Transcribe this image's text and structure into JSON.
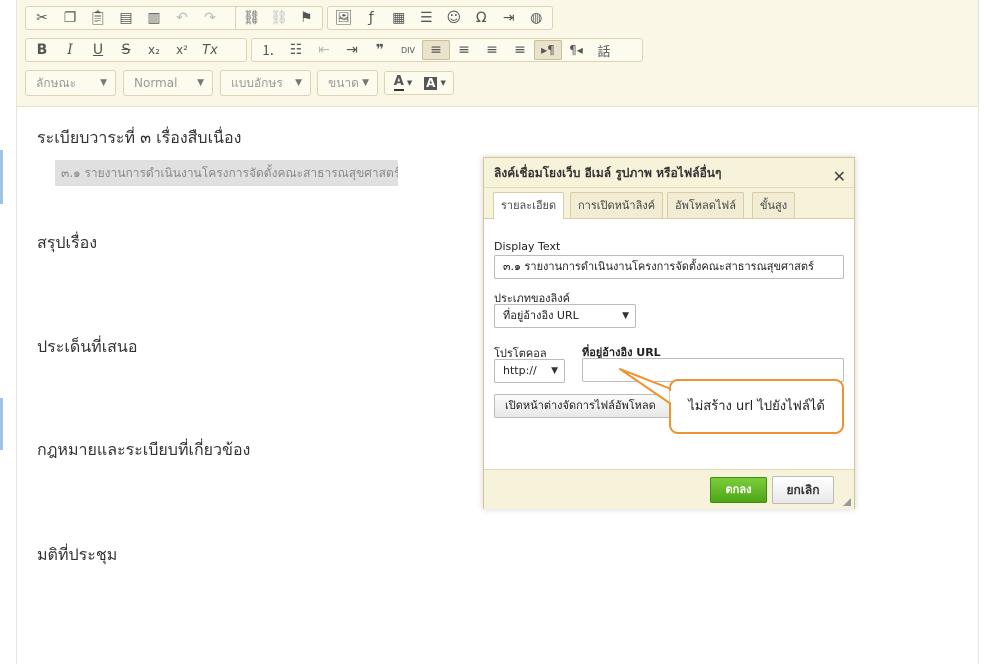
{
  "toolbar": {
    "row1": [
      "cut-icon",
      "copy-icon",
      "paste-icon",
      "paste-text-icon",
      "paste-word-icon",
      "undo-icon",
      "redo-icon",
      "link-icon",
      "unlink-icon",
      "anchor-icon",
      "image-icon",
      "flash-icon",
      "table-icon",
      "horizontal-rule-icon",
      "smiley-icon",
      "special-char-icon",
      "page-break-icon",
      "iframe-icon"
    ],
    "row2_glyphs": {
      "bold": "B",
      "italic": "I",
      "underline": "U",
      "strike": "S",
      "subscript": "x₂",
      "superscript": "x²",
      "remove_format": "Tx",
      "numbered_list": "⒈",
      "bulleted_list": "☷",
      "outdent": "⇤",
      "indent": "⇥",
      "blockquote": "❞",
      "div": "DIV",
      "align_left": "≡",
      "align_center": "≡",
      "align_right": "≡",
      "justify": "≡",
      "ltr": "▸¶",
      "rtl": "¶◂",
      "language": "話"
    },
    "styles_placeholder": "ลักษณะ",
    "format_value": "Normal",
    "font_placeholder": "แบบอักษร",
    "size_placeholder": "ขนาด",
    "text_color_glyph": "A",
    "bg_color_glyph": "A"
  },
  "content": {
    "line1": "ระเบียบวาระที่    ๓    เรื่องสืบเนื่อง",
    "selected_text": "๓.๑  รายงานการดำเนินงานโครงการจัดตั้งคณะสาธารณสุขศาสตร์",
    "h_summary": "สรุปเรื่อง",
    "h_issues": "ประเด็นที่เสนอ",
    "h_laws": "กฎหมายและระเบียบที่เกี่ยวข้อง",
    "h_resolution": "มติที่ประชุม"
  },
  "dialog": {
    "title": "ลิงค์เชื่อมโยงเว็บ อีเมล์ รูปภาพ หรือไฟล์อื่นๆ",
    "close": "✕",
    "tabs": [
      "รายละเอียด",
      "การเปิดหน้าลิงค์",
      "อัพโหลดไฟล์",
      "ขั้นสูง"
    ],
    "display_text_label": "Display Text",
    "display_text_value": "๓.๑  รายงานการดำเนินงานโครงการจัดตั้งคณะสาธารณสุขศาสตร์",
    "link_type_label": "ประเภทของลิงค์",
    "link_type_value": "ที่อยู่อ้างอิง URL",
    "protocol_label": "โปรโตคอล",
    "protocol_value": "http://",
    "url_label": "ที่อยู่อ้างอิง URL",
    "url_value": "",
    "upload_button": "เปิดหน้าต่างจัดการไฟล์อัพโหลด",
    "ok_button": "ตกลง",
    "cancel_button": "ยกเลิก"
  },
  "callout": {
    "text": "ไม่สร้าง url ไปยังไฟล์ได้",
    "border_color": "#f0922f"
  }
}
